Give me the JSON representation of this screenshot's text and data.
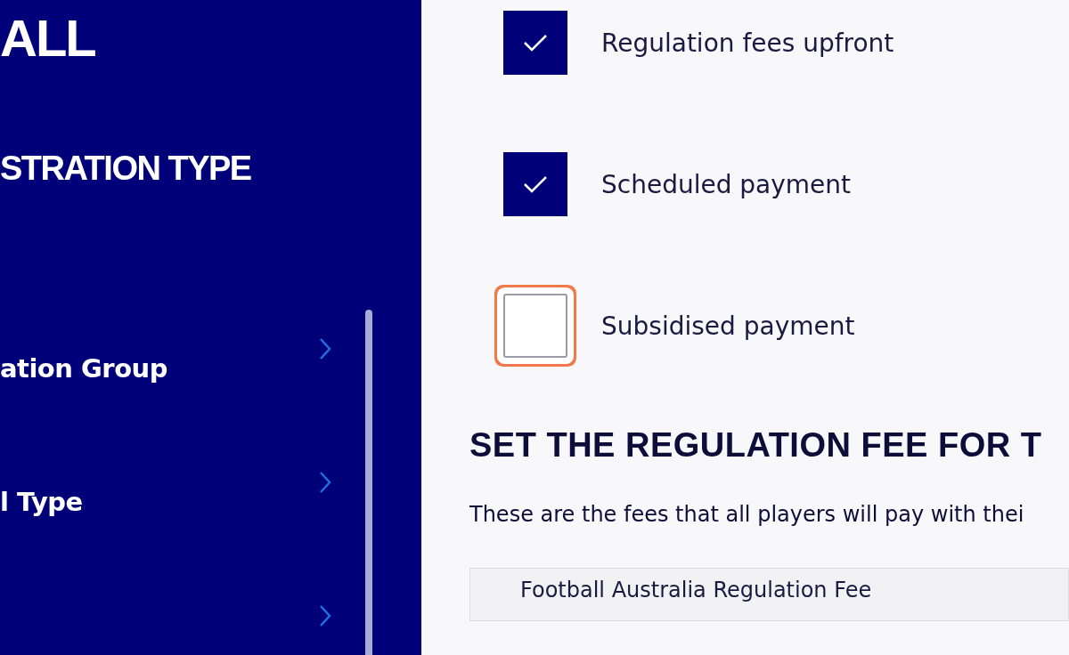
{
  "sidebar": {
    "brand": "ALL",
    "heading": "STRATION TYPE",
    "items": [
      {
        "kind": "link",
        "label": "ation Group"
      },
      {
        "kind": "link",
        "label": "l Type"
      },
      {
        "kind": "hidden"
      }
    ]
  },
  "options": [
    {
      "label": "Regulation fees upfront",
      "checked": true,
      "focused": false
    },
    {
      "label": "Scheduled payment",
      "checked": true,
      "focused": false
    },
    {
      "label": "Subsidised payment",
      "checked": false,
      "focused": true
    }
  ],
  "section": {
    "title": "SET THE REGULATION FEE FOR T",
    "description": "These are the fees that all players will pay with thei",
    "fee_row": "Football Australia Regulation Fee"
  }
}
